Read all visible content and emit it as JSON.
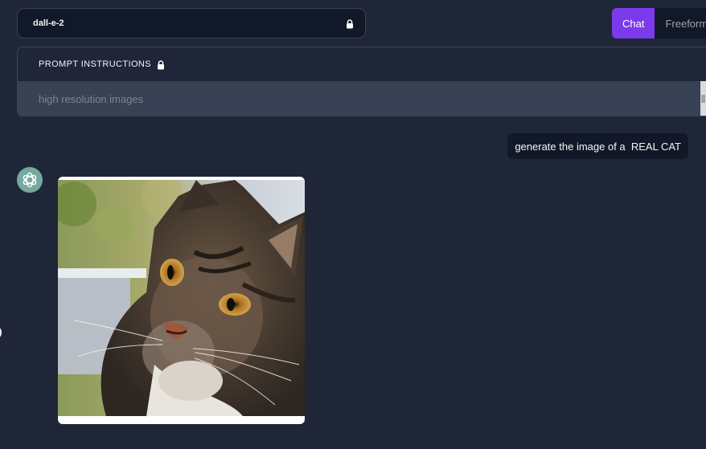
{
  "header": {
    "model_name": "dall-e-2",
    "modes": [
      {
        "label": "Chat",
        "active": true
      },
      {
        "label": "Freeform",
        "active": false
      }
    ]
  },
  "prompt_panel": {
    "title": "PROMPT INSTRUCTIONS",
    "placeholder": "high resolution images"
  },
  "conversation": {
    "user_message": "generate the image of a  REAL CAT",
    "assistant_image_alt": "photo of a tabby cat"
  },
  "colors": {
    "background": "#1f2637",
    "accent": "#7c3aed",
    "avatar": "#74aa9c"
  }
}
